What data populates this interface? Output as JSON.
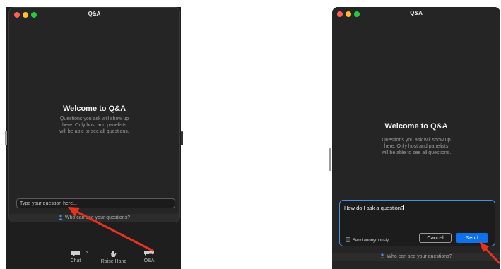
{
  "left": {
    "title": "Q&A",
    "welcome_title": "Welcome to Q&A",
    "welcome_body_lines": [
      "Questions you ask will show up",
      "here. Only host and panelists",
      "will be able to see all questions."
    ],
    "input_placeholder": "Type your question here...",
    "who_can_see": "Who can see your questions?",
    "toolbar": {
      "chat": "Chat",
      "caret": "^",
      "raise_hand": "Raise Hand",
      "qa": "Q&A"
    }
  },
  "right": {
    "title": "Q&A",
    "welcome_title": "Welcome to Q&A",
    "welcome_body_lines": [
      "Questions you ask will show up",
      "here. Only host and panelists",
      "will be able to see all questions."
    ],
    "compose_text": "How do I ask a question?",
    "send_anonymously": "Send anonymously",
    "cancel": "Cancel",
    "send": "Send",
    "who_can_see": "Who can see your questions?"
  },
  "colors": {
    "arrow": "#e8321e",
    "send_button": "#0e72ed",
    "focus_border": "#4a90e2"
  },
  "icons": [
    "chat-icon",
    "raise-hand-icon",
    "qa-icon",
    "person-icon",
    "arrow-annotation"
  ]
}
